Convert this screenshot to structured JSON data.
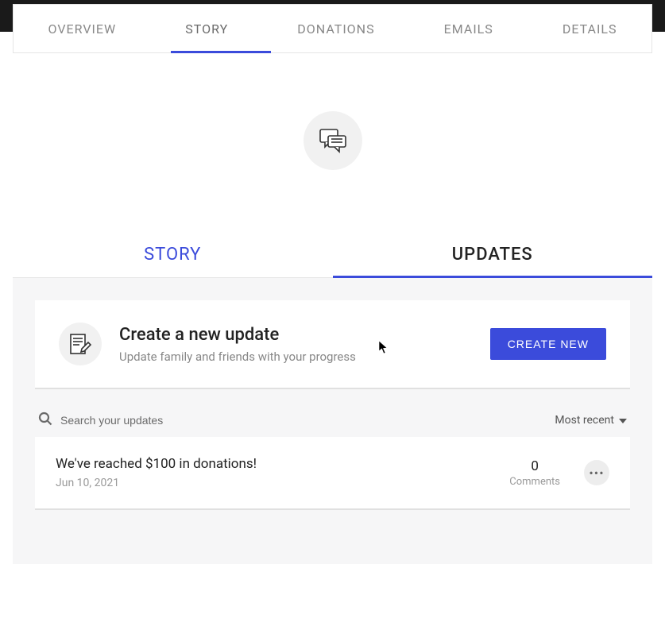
{
  "main_tabs": {
    "overview": "OVERVIEW",
    "story": "STORY",
    "donations": "DONATIONS",
    "emails": "EMAILS",
    "details": "DETAILS"
  },
  "sub_tabs": {
    "story": "STORY",
    "updates": "UPDATES"
  },
  "create_card": {
    "title": "Create a new update",
    "subtitle": "Update family and friends with your progress",
    "button": "CREATE NEW"
  },
  "search": {
    "placeholder": "Search your updates"
  },
  "sort": {
    "label": "Most recent"
  },
  "updates": [
    {
      "title": "We've reached $100 in donations!",
      "date": "Jun 10, 2021",
      "comments_count": "0",
      "comments_label": "Comments"
    }
  ]
}
